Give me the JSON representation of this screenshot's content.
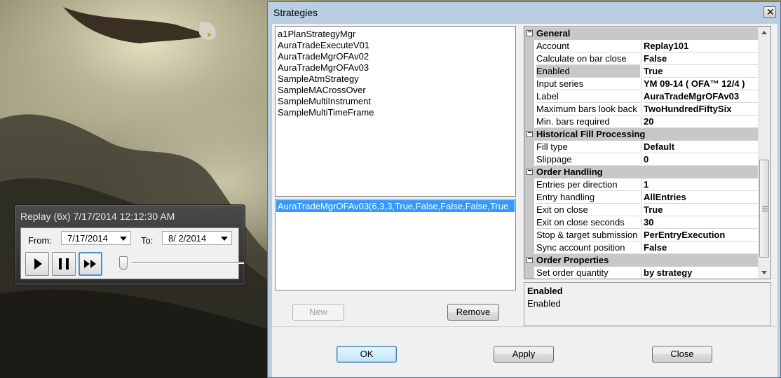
{
  "replay": {
    "title": "Replay (6x) 7/17/2014 12:12:30 AM",
    "from_label": "From:",
    "from_value": "7/17/2014",
    "to_label": "To:",
    "to_value": "8/  2/2014",
    "icons": {
      "play": "play-icon",
      "pause": "pause-icon",
      "fast_forward": "fast-forward-icon"
    }
  },
  "dialog": {
    "title": "Strategies",
    "close_glyph": "✕",
    "strategies": [
      "a1PlanStrategyMgr",
      "AuraTradeExecuteV01",
      "AuraTradeMgrOFAv02",
      "AuraTradeMgrOFAv03",
      "SampleAtmStrategy",
      "SampleMACrossOver",
      "SampleMultiInstrument",
      "SampleMultiTimeFrame"
    ],
    "selected_instance": "AuraTradeMgrOFAv03(6,3,3,True,False,False,False,True",
    "new_label": "New",
    "remove_label": "Remove",
    "ok_label": "OK",
    "apply_label": "Apply",
    "close_label": "Close"
  },
  "properties": {
    "general": {
      "name": "General",
      "rows": [
        {
          "name": "Account",
          "value": "Replay101"
        },
        {
          "name": "Calculate on bar close",
          "value": "False"
        },
        {
          "name": "Enabled",
          "value": "True"
        },
        {
          "name": "Input series",
          "value": "YM 09-14 ( OFA™ 12/4 )"
        },
        {
          "name": "Label",
          "value": "AuraTradeMgrOFAv03"
        },
        {
          "name": "Maximum bars look back",
          "value": "TwoHundredFiftySix"
        },
        {
          "name": "Min. bars required",
          "value": "20"
        }
      ]
    },
    "historical": {
      "name": "Historical Fill Processing",
      "rows": [
        {
          "name": "Fill type",
          "value": "Default"
        },
        {
          "name": "Slippage",
          "value": "0"
        }
      ]
    },
    "order_handling": {
      "name": "Order Handling",
      "rows": [
        {
          "name": "Entries per direction",
          "value": "1"
        },
        {
          "name": "Entry handling",
          "value": "AllEntries"
        },
        {
          "name": "Exit on close",
          "value": "True"
        },
        {
          "name": "Exit on close seconds",
          "value": "30"
        },
        {
          "name": "Stop & target submission",
          "value": "PerEntryExecution"
        },
        {
          "name": "Sync account position",
          "value": "False"
        }
      ]
    },
    "order_properties": {
      "name": "Order Properties",
      "rows": [
        {
          "name": "Set order quantity",
          "value": "by strategy"
        }
      ]
    },
    "collapse_glyph": "−"
  },
  "help": {
    "title": "Enabled",
    "description": "Enabled"
  }
}
